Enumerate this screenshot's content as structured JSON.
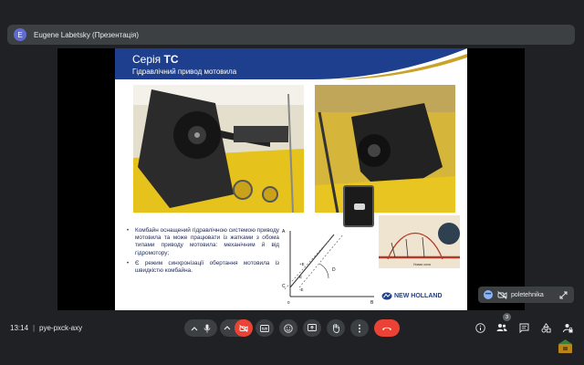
{
  "presenter": {
    "avatar_letter": "E",
    "name": "Eugene Labetsky (Презентація)",
    "avatar_color": "#5f6bcf"
  },
  "slide": {
    "title_prefix": "Серія ",
    "title_bold": "TC",
    "subtitle": "Гідравлічний привод мотовила",
    "header_color": "#1d3f8e",
    "bullets": [
      "Комбайн оснащений гідравлічною системою приводу мотовила та може працювати із жатками з обома типами приводу мотовила: механічним й від гідромотору;",
      "Є режим синхронізації обертання мотовила із швидкістю комбайна."
    ],
    "graph_labels": {
      "a": "A",
      "b": "B",
      "c": "C",
      "d": "D",
      "e": "E",
      "plus_e": "+E",
      "minus_e": "-E",
      "zero": "0"
    },
    "diagram_caption": "Новая сила",
    "logo": "NEW HOLLAND"
  },
  "self_view": {
    "name": "poletehnika"
  },
  "bottom_bar": {
    "time": "13:14",
    "separator": "|",
    "meeting_code": "pye-pxck-axy",
    "participants_count": "3"
  },
  "colors": {
    "end_call": "#ea4335",
    "bar_bg": "#3c4043",
    "background": "#202124"
  }
}
